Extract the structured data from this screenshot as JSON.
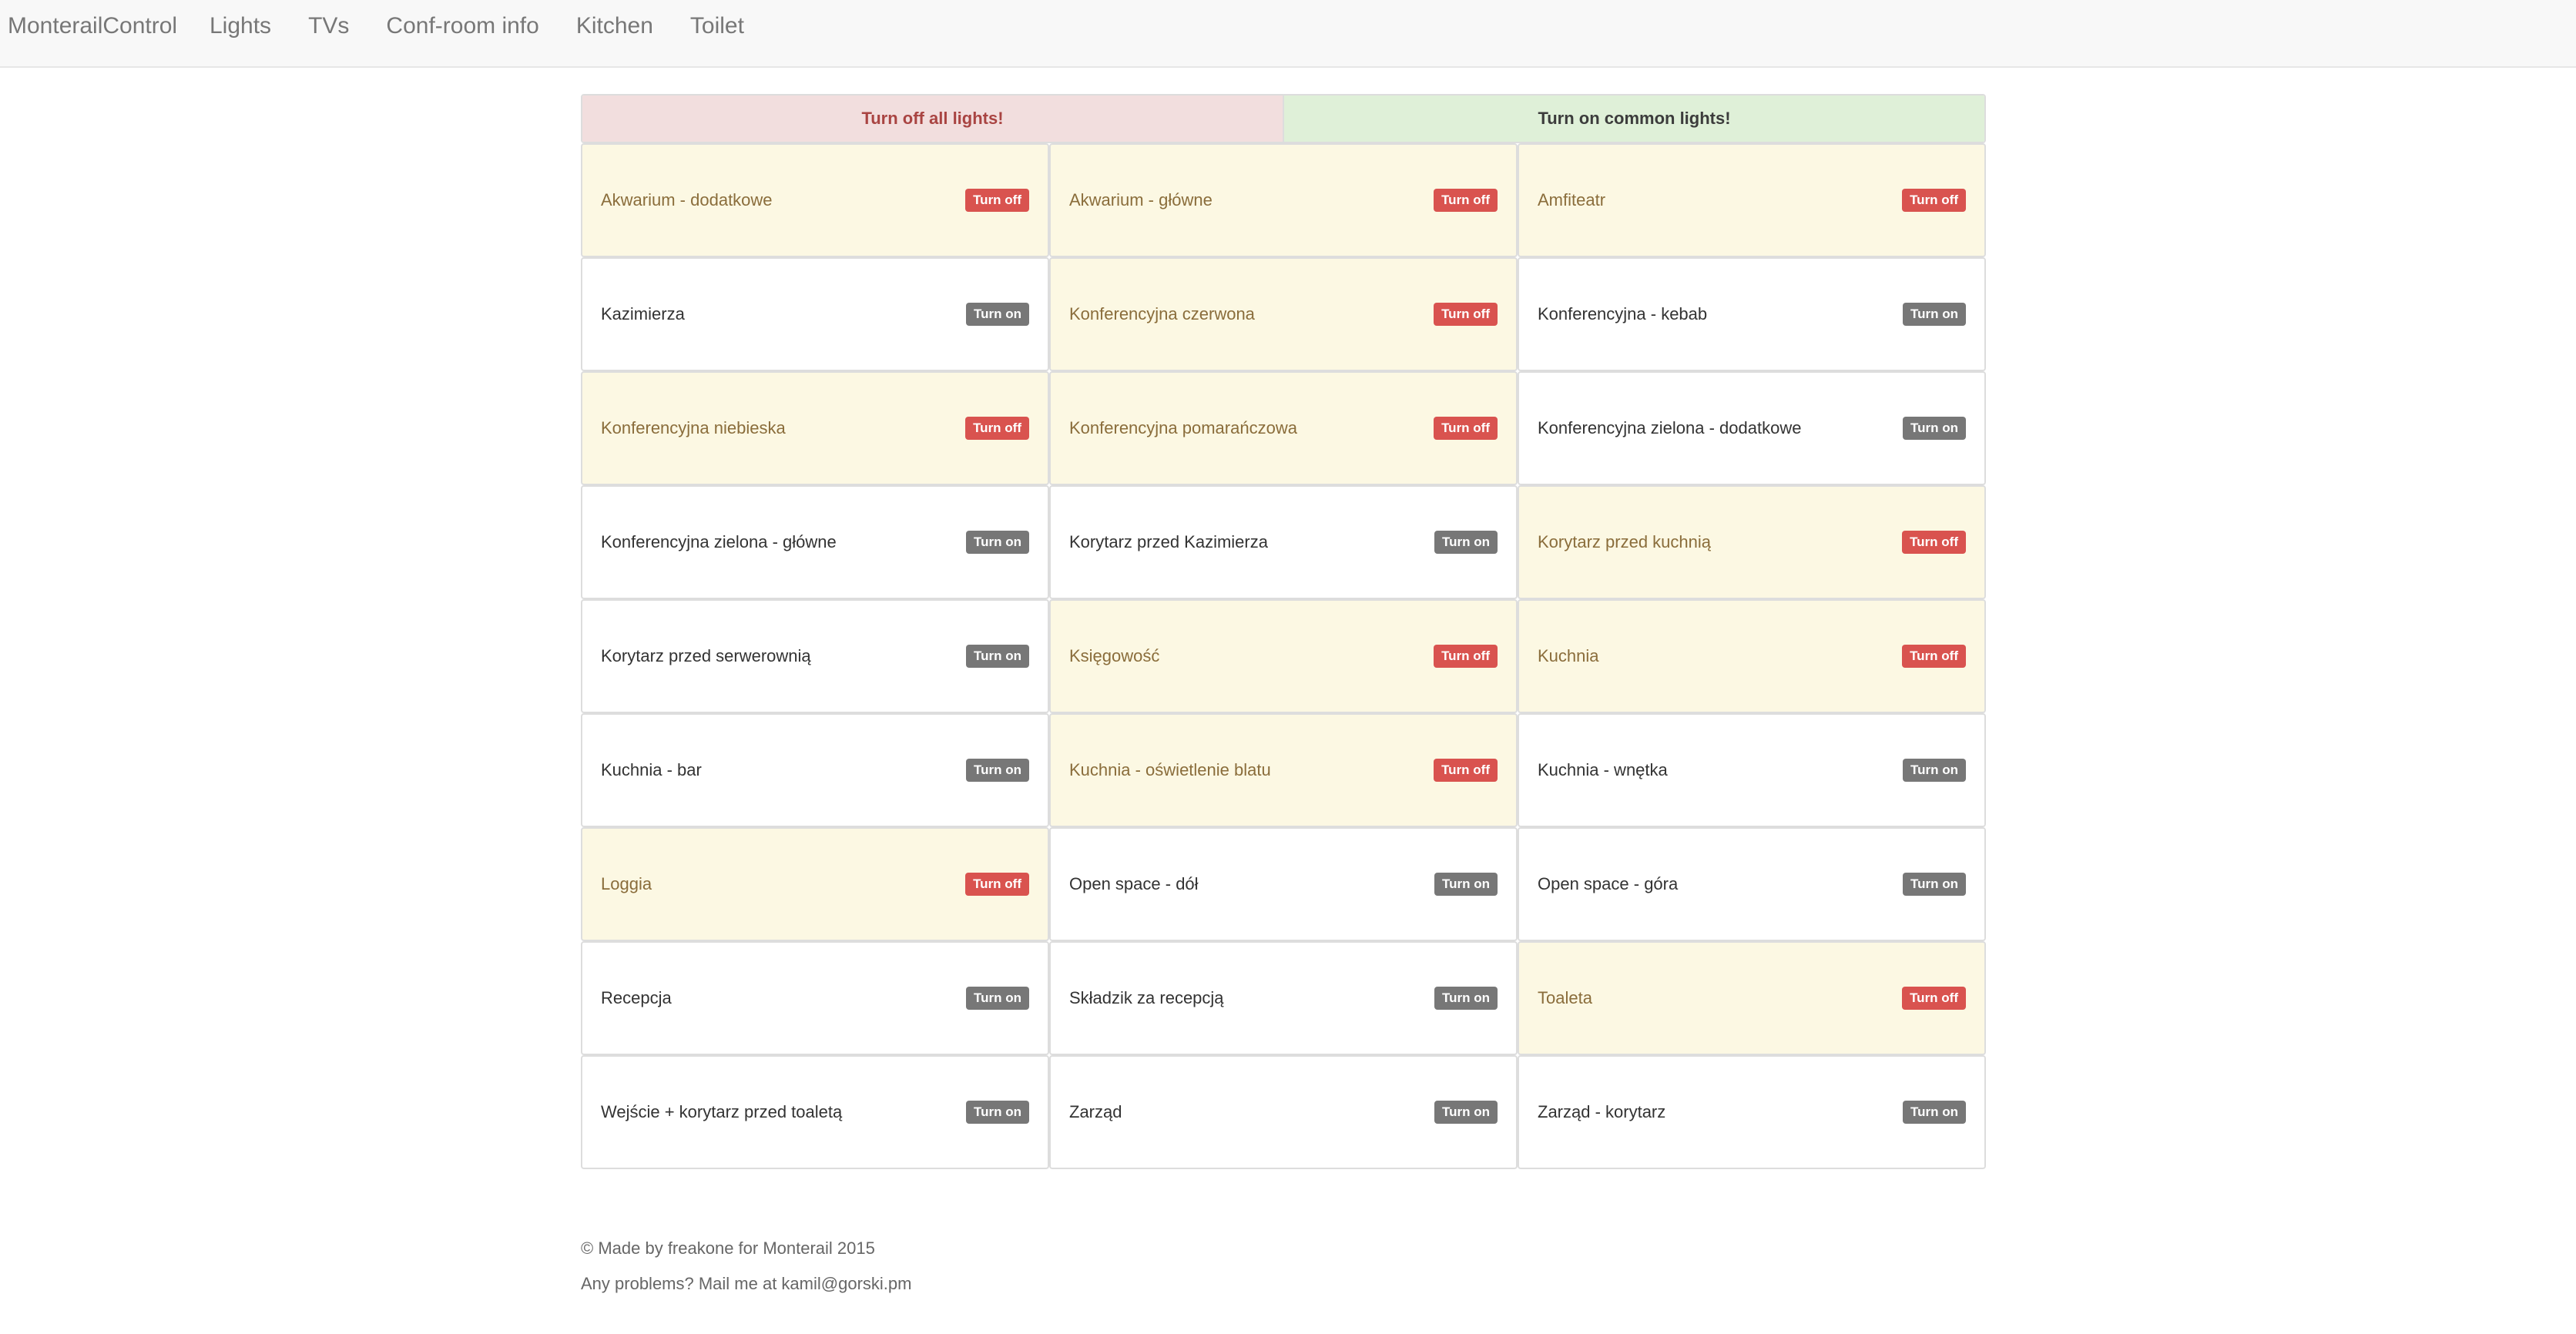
{
  "navbar": {
    "brand": "MonterailControl",
    "links": [
      "Lights",
      "TVs",
      "Conf-room info",
      "Kitchen",
      "Toilet"
    ]
  },
  "bulk": {
    "off_label": "Turn off all lights!",
    "on_label": "Turn on common lights!"
  },
  "labels": {
    "turn_on": "Turn on",
    "turn_off": "Turn off"
  },
  "lights": [
    {
      "name": "Akwarium - dodatkowe",
      "on": true
    },
    {
      "name": "Akwarium - główne",
      "on": true
    },
    {
      "name": "Amfiteatr",
      "on": true
    },
    {
      "name": "Kazimierza",
      "on": false
    },
    {
      "name": "Konferencyjna czerwona",
      "on": true
    },
    {
      "name": "Konferencyjna - kebab",
      "on": false
    },
    {
      "name": "Konferencyjna niebieska",
      "on": true
    },
    {
      "name": "Konferencyjna pomarańczowa",
      "on": true
    },
    {
      "name": "Konferencyjna zielona - dodatkowe",
      "on": false
    },
    {
      "name": "Konferencyjna zielona - główne",
      "on": false
    },
    {
      "name": "Korytarz przed Kazimierza",
      "on": false
    },
    {
      "name": "Korytarz przed kuchnią",
      "on": true
    },
    {
      "name": "Korytarz przed serwerownią",
      "on": false
    },
    {
      "name": "Księgowość",
      "on": true
    },
    {
      "name": "Kuchnia",
      "on": true
    },
    {
      "name": "Kuchnia - bar",
      "on": false
    },
    {
      "name": "Kuchnia - oświetlenie blatu",
      "on": true
    },
    {
      "name": "Kuchnia - wnętka",
      "on": false
    },
    {
      "name": "Loggia",
      "on": true
    },
    {
      "name": "Open space - dół",
      "on": false
    },
    {
      "name": "Open space - góra",
      "on": false
    },
    {
      "name": "Recepcja",
      "on": false
    },
    {
      "name": "Składzik za recepcją",
      "on": false
    },
    {
      "name": "Toaleta",
      "on": true
    },
    {
      "name": "Wejście + korytarz przed toaletą",
      "on": false
    },
    {
      "name": "Zarząd",
      "on": false
    },
    {
      "name": "Zarząd - korytarz",
      "on": false
    }
  ],
  "footer": {
    "credit": "© Made by freakone for Monterail 2015",
    "contact": "Any problems? Mail me at kamil@gorski.pm"
  },
  "colors": {
    "lit_bg": "#fcf8e3",
    "lit_text": "#8a6d3b",
    "off_badge": "#d9534f",
    "on_badge": "#777777",
    "bulk_off_bg": "#f2dede",
    "bulk_on_bg": "#dff0d8"
  }
}
